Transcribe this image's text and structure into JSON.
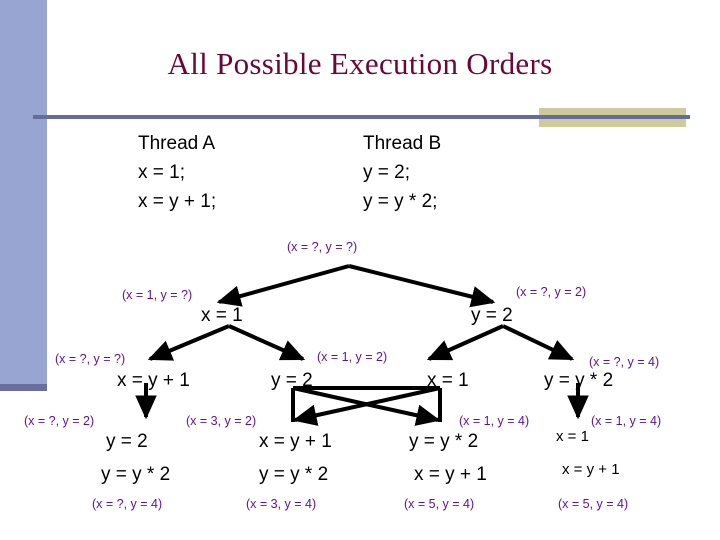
{
  "slide": {
    "title": "All Possible Execution Orders"
  },
  "threads": {
    "a": {
      "name": "Thread A",
      "lines": [
        "x = 1;",
        "x = y + 1;"
      ]
    },
    "b": {
      "name": "Thread B",
      "lines": [
        "y = 2;",
        "y = y * 2;"
      ]
    }
  },
  "tree": {
    "root_state": "(x = ?, y = ?)",
    "level1": [
      {
        "state": "(x = 1, y = ?)",
        "code": "x = 1"
      },
      {
        "state": "(x = ?, y = 2)",
        "code": "y = 2"
      }
    ],
    "level2": [
      {
        "state": "(x = ?, y = ?)",
        "code": "x = y + 1"
      },
      {
        "state": "(x = 1, y = 2)",
        "code": "y = 2"
      },
      {
        "state": "(x = 1, y = 2)",
        "code": "x = 1"
      },
      {
        "state": "(x = ?, y = 4)",
        "code": "y = y * 2"
      }
    ],
    "level3": [
      {
        "state": "(x = ?, y = 2)",
        "code": "y = 2"
      },
      {
        "state": "(x = 3, y = 2)",
        "code": "x = y + 1"
      },
      {
        "state": "(x = 1, y = 4)",
        "code": "y = y * 2"
      },
      {
        "state": "(x = 1, y = 4)",
        "code": "x = 1"
      }
    ],
    "level4": [
      {
        "code": "y = y * 2",
        "state": "(x = ?, y = 4)"
      },
      {
        "code": "y = y * 2",
        "state": "(x = 3, y = 4)"
      },
      {
        "code": "x = y + 1",
        "state": "(x = 5, y = 4)"
      },
      {
        "code": "x = y + 1",
        "state": "(x = 5, y = 4)"
      }
    ]
  },
  "colors": {
    "title": "#6b0735",
    "state_text": "#5b1396",
    "code_text": "#000000",
    "sidebar": "#98a4d2",
    "sidebar_foot": "#6a6e9e",
    "rule": "#676b9b",
    "accent_block": "#cdcb9b",
    "wire": "#000000"
  }
}
